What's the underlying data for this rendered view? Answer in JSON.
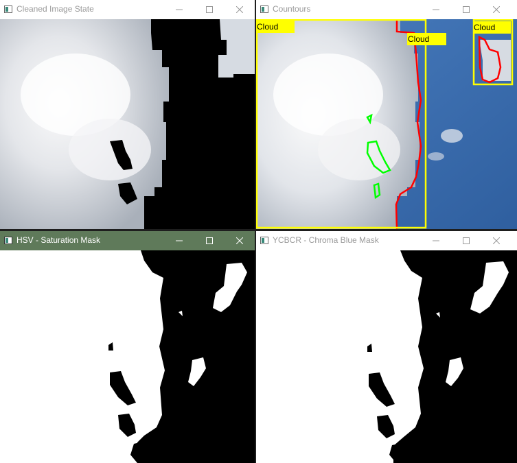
{
  "windows": {
    "cleaned": {
      "title": "Cleaned Image State"
    },
    "contours": {
      "title": "Countours",
      "labels": [
        "Cloud",
        "Cloud",
        "Cloud"
      ]
    },
    "hsv": {
      "title": "HSV - Saturation Mask"
    },
    "ycbcr": {
      "title": "YCBCR - Chroma Blue Mask"
    }
  },
  "colors": {
    "active_titlebar": "#5f7a5a",
    "label_yellow": "#ffff00",
    "contour_red": "#ff0000",
    "contour_green": "#00ff00",
    "sky_blue": "#3e6fb0"
  }
}
